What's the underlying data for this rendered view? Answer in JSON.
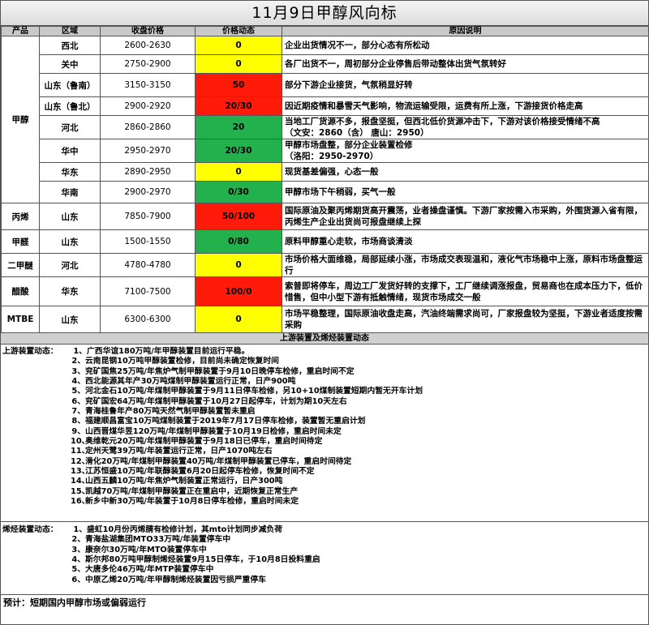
{
  "title": "11月9日甲醇风向标",
  "headers": {
    "product": "产品",
    "region": "区域",
    "price": "收盘价格",
    "move": "价格动态",
    "reason": "原因说明"
  },
  "rows": [
    {
      "product": "甲醇",
      "region": "西北",
      "price": "2600-2630",
      "move": "0",
      "color": "#ffff00",
      "reason": [
        "企业出货情况不一，部分心态有所松动"
      ]
    },
    {
      "product": "",
      "region": "关中",
      "price": "2750-2900",
      "move": "0",
      "color": "#ffff00",
      "reason": [
        "各厂出货不一，周初部分企业停售后带动整体出货气氛转好"
      ]
    },
    {
      "product": "",
      "region": "山东（鲁南）",
      "price": "3150-3150",
      "move": "50",
      "color": "#ff1a0a",
      "reason": [
        "部分下游企业接货，气氛稍显好转"
      ]
    },
    {
      "product": "",
      "region": "山东（鲁北）",
      "price": "2900-2920",
      "move": "20/30",
      "color": "#ff1a0a",
      "reason": [
        "因近期疫情和暴雪天气影响，物流运输受限，运费有所上涨，下游接货价格走高"
      ]
    },
    {
      "product": "",
      "region": "河北",
      "price": "2860-2860",
      "move": "20",
      "color": "#22b14c",
      "reason": [
        "当地工厂货源不多，报盘坚挺，但西北低价货源冲击下，下游对该价格接受情绪不高",
        "（文安：2860（含） 唐山：2950）"
      ]
    },
    {
      "product": "",
      "region": "华中",
      "price": "2950-2970",
      "move": "20/30",
      "color": "#22b14c",
      "reason": [
        "甲醇市场盘整，部分企业装置检修",
        "（洛阳：2950-2970）"
      ]
    },
    {
      "product": "",
      "region": "华东",
      "price": "2890-2950",
      "move": "0",
      "color": "#ffff00",
      "reason": [
        "现货基差偏强，心态一般"
      ]
    },
    {
      "product": "",
      "region": "华南",
      "price": "2900-2970",
      "move": "0/30",
      "color": "#22b14c",
      "reason": [
        "甲醇市场下午稍弱，买气一般"
      ]
    },
    {
      "product": "丙烯",
      "region": "山东",
      "price": "7850-7900",
      "move": "50/100",
      "color": "#ff1a0a",
      "reason": [
        "国际原油及聚丙烯期货高开震荡，业者操盘谨慎。下游厂家按需入市采购，外围货源入省有限，丙烯生产企业出货尚可报盘继续上探"
      ]
    },
    {
      "product": "甲醛",
      "region": "山东",
      "price": "1500-1550",
      "move": "0/80",
      "color": "#22b14c",
      "reason": [
        "原料甲醇重心走软，市场商谈清淡"
      ]
    },
    {
      "product": "二甲醚",
      "region": "河北",
      "price": "4780-4780",
      "move": "0",
      "color": "#ffff00",
      "reason": [
        "市场价格大面维稳，局部延续小涨，市场成交表现温和，液化气市场稳中上涨，原料市场盘整运行"
      ]
    },
    {
      "product": "醋酸",
      "region": "华东",
      "price": "7100-7500",
      "move": "100/0",
      "color": "#ff1a0a",
      "reason": [
        "索普即将停车，周边工厂发货好转的支撑下，工厂继续调涨报盘，贸易商也在成本压力下，低价惜售，但中小型下游有抵触情绪，现货市场成交一般"
      ]
    },
    {
      "product": "MTBE",
      "region": "山东",
      "price": "6300-6300",
      "move": "0",
      "color": "#ffff00",
      "reason": [
        "市场平稳整理，国际原油收盘走高，汽油终端需求尚可，厂家报盘较为坚挺，下游业者适度按需采购"
      ]
    }
  ],
  "upstream_title": "上游装置及烯烃装置动态",
  "upstream": {
    "label": "上游装置动态：",
    "items": [
      "广西华谊180万吨/年甲醇装置目前运行平稳。",
      "云南昆钢10万吨甲醇装置检修，目前尚未确定恢复时间",
      "兖矿国焦25万吨/年焦炉气制甲醇装置于9月10日晚停车检修，重启时间不定",
      "西北能源其年产30万吨煤制甲醇装置运行正常，日产900吨",
      "河北金石10万吨/年煤制甲醇装置于9月11日停车检修，另10+10煤制装置短期内暂无开车计划",
      "兖矿国宏64万吨/年煤制甲醇装置于10月27日起停车，计划为期10天左右",
      "青海桂鲁年产80万吨天然气制甲醇装置暂未重启",
      "福建顺昌富宝10万吨煤制装置于2019年7月17日停车检修，装置暂无重启计划",
      "山西晋煤华昱120万吨/年煤制甲醇装置于10月19日检修，重启时间未定",
      "奥维乾元20万吨/年煤制甲醇装置于9月18日已停车，重启时间待定",
      "定州天鹭39万吨/年装置运行正常，日产1070吨左右",
      "滑化20万吨/年煤制甲醇装置40万吨/年煤制甲醇装置已停车，重启时间待定",
      "江苏恒盛10万吨/年联醇装置6月20日起停车检修，恢复时间不定",
      "山西五麟10万吨/年焦炉气制装置正常运行，日产300吨",
      "凯越70万吨/年煤制甲醇装置正在重启中，近期恢复正常生产",
      "新乡中新30万吨/年装置于10月8日停车检修，重启时间未定"
    ]
  },
  "olefin": {
    "label": "烯烃装置动态：",
    "items": [
      "盛虹10月份丙烯腈有检修计划，其mto计划同步减负荷",
      "青海盐湖集团MTO33万吨/年装置停车中",
      "康奈尔30万吨/年MTO装置停车中",
      "斯尔邦80万吨甲醇制烯烃装置9月15日停车，于10月8日投料重启",
      "大唐多伦46万吨/年MTP装置停车中",
      "中原乙烯20万吨/年甲醇制烯烃装置因亏损严重停车"
    ]
  },
  "forecast": "预计：短期国内甲醇市场或偏弱运行"
}
